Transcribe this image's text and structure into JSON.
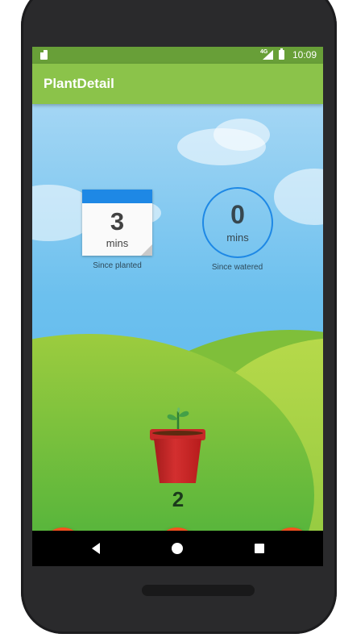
{
  "status_bar": {
    "time": "10:09",
    "network": "4G"
  },
  "app_bar": {
    "title": "PlantDetail"
  },
  "planted": {
    "value": "3",
    "unit": "mins",
    "label": "Since planted"
  },
  "watered": {
    "value": "0",
    "unit": "mins",
    "label": "Since watered"
  },
  "plant": {
    "count": "2"
  },
  "actions": {
    "back_icon": "arrow-left-icon",
    "water_icon": "water-drop-icon",
    "cut_icon": "scissors-icon"
  },
  "colors": {
    "status_bar": "#689f38",
    "app_bar": "#8bc34a",
    "accent": "#f4511e",
    "calendar_header": "#1e88e5",
    "pot": "#c62828"
  }
}
